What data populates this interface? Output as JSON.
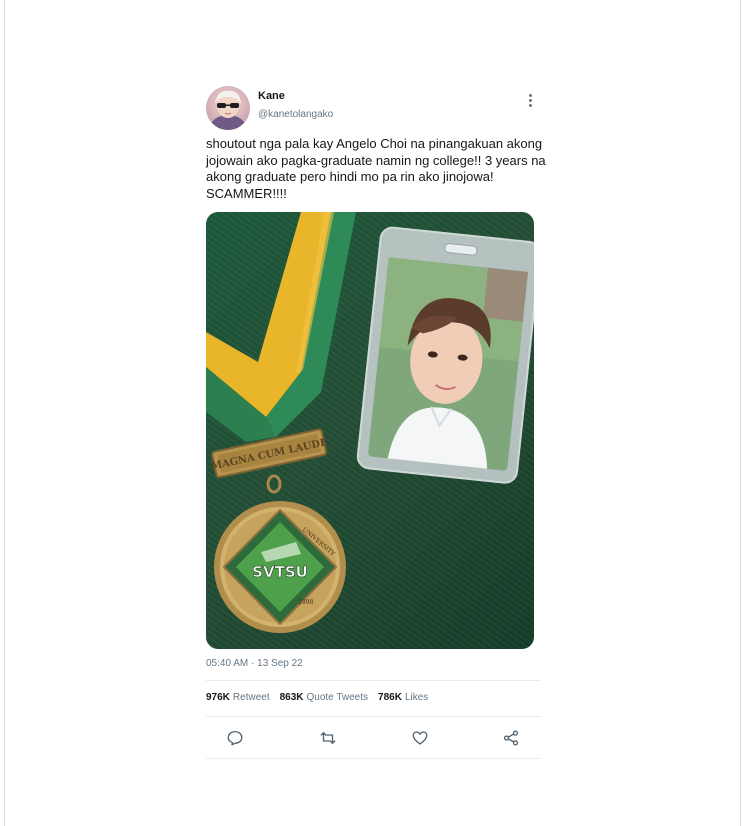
{
  "tweet": {
    "display_name": "Kane",
    "handle": "@kanetolangako",
    "text": "shoutout nga pala kay Angelo Choi na pinangakuan akong jojowain ako pagka-graduate namin ng college!! 3 years na akong graduate pero hindi mo pa rin ako jinojowa! SCAMMER!!!!",
    "timestamp": "05:40 AM · 13 Sep 22",
    "stats": {
      "retweets_count": "976K",
      "retweets_label": "Retweet",
      "quotes_count": "863K",
      "quotes_label": "Quote Tweets",
      "likes_count": "786K",
      "likes_label": "Likes"
    },
    "media": {
      "medal_plate": "MAGNA CUM LAUDE",
      "medal_center": "SVTSU",
      "medal_ring_top": "UNIVERSITY",
      "medal_year": "1998"
    }
  },
  "icons": {
    "more": "more-vertical-icon",
    "reply": "reply-icon",
    "retweet": "retweet-icon",
    "like": "heart-icon",
    "share": "share-icon"
  },
  "colors": {
    "text": "#14171a",
    "secondary": "#657786",
    "divider": "#e6ecf0",
    "icon": "#536471"
  }
}
